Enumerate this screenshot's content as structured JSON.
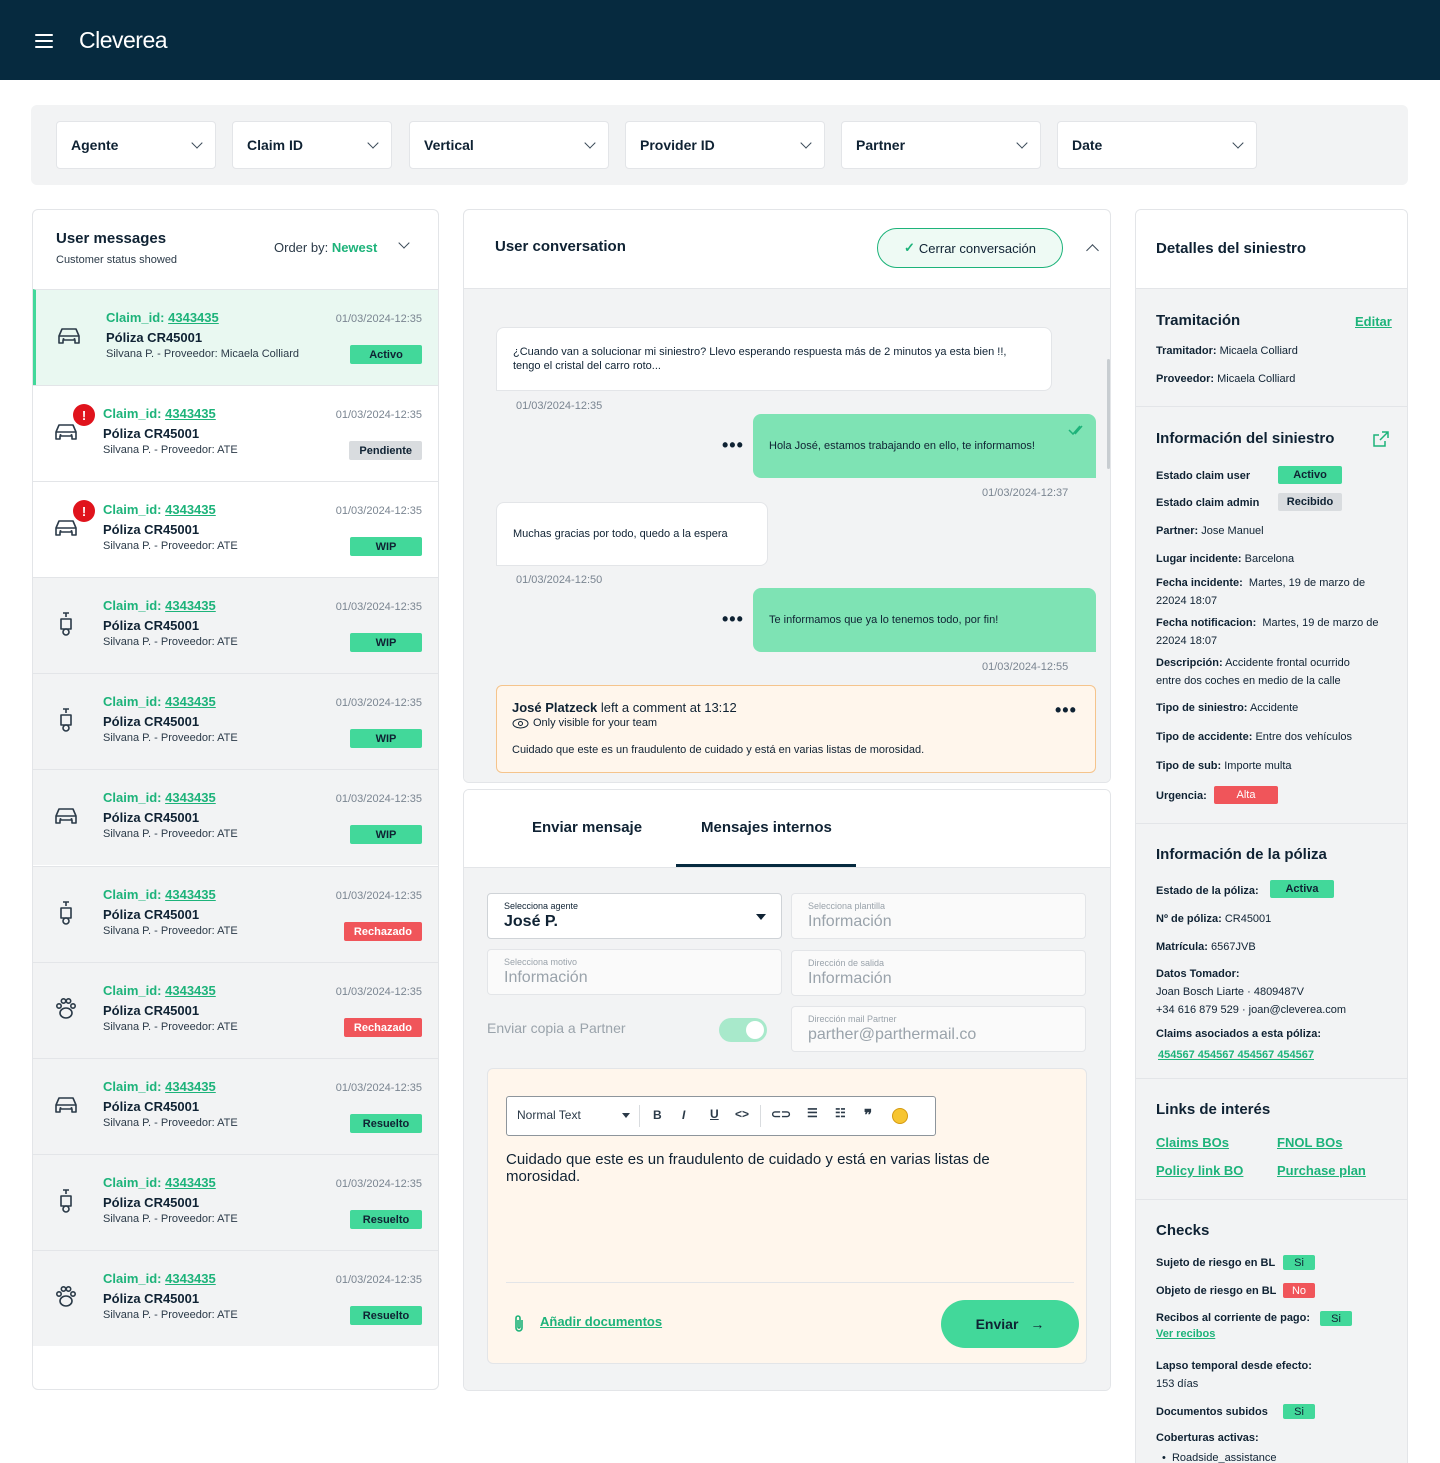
{
  "app": {
    "title": "Cleverea"
  },
  "filters": [
    "Agente",
    "Claim ID",
    "Vertical",
    "Provider ID",
    "Partner",
    "Date"
  ],
  "messages_panel": {
    "title": "User messages",
    "subtitle": "Customer status showed",
    "order_by_label": "Order by:",
    "order_by_value": "Newest",
    "items": [
      {
        "claim_label": "Claim_id:",
        "claim_id": "4343435",
        "policy": "Póliza CR45001",
        "provider": "Silvana P. - Proveedor: Micaela Colliard",
        "date": "01/03/2024-12:35",
        "status": "Activo",
        "status_color": "green",
        "icon": "car-icon",
        "alert": false,
        "active": true,
        "grey": false
      },
      {
        "claim_label": "Claim_id:",
        "claim_id": "4343435",
        "policy": "Póliza CR45001",
        "provider": "Silvana P. - Proveedor: ATE",
        "date": "01/03/2024-12:35",
        "status": "Pendiente",
        "status_color": "grey",
        "icon": "car-icon",
        "alert": true,
        "active": false,
        "grey": false
      },
      {
        "claim_label": "Claim_id:",
        "claim_id": "4343435",
        "policy": "Póliza CR45001",
        "provider": "Silvana P. - Proveedor: ATE",
        "date": "01/03/2024-12:35",
        "status": "WIP",
        "status_color": "green",
        "icon": "car-icon",
        "alert": true,
        "active": false,
        "grey": false
      },
      {
        "claim_label": "Claim_id:",
        "claim_id": "4343435",
        "policy": "Póliza CR45001",
        "provider": "Silvana P. - Proveedor: ATE",
        "date": "01/03/2024-12:35",
        "status": "WIP",
        "status_color": "green",
        "icon": "scooter-icon",
        "alert": false,
        "active": false,
        "grey": true
      },
      {
        "claim_label": "Claim_id:",
        "claim_id": "4343435",
        "policy": "Póliza CR45001",
        "provider": "Silvana P. - Proveedor: ATE",
        "date": "01/03/2024-12:35",
        "status": "WIP",
        "status_color": "green",
        "icon": "scooter-icon",
        "alert": false,
        "active": false,
        "grey": true
      },
      {
        "claim_label": "Claim_id:",
        "claim_id": "4343435",
        "policy": "Póliza CR45001",
        "provider": "Silvana P. - Proveedor: ATE",
        "date": "01/03/2024-12:35",
        "status": "WIP",
        "status_color": "green",
        "icon": "car-icon",
        "alert": false,
        "active": false,
        "grey": true
      },
      {
        "claim_label": "Claim_id:",
        "claim_id": "4343435",
        "policy": "Póliza CR45001",
        "provider": "Silvana P. - Proveedor: ATE",
        "date": "01/03/2024-12:35",
        "status": "Rechazado",
        "status_color": "red",
        "icon": "scooter-icon",
        "alert": false,
        "active": false,
        "grey": true
      },
      {
        "claim_label": "Claim_id:",
        "claim_id": "4343435",
        "policy": "Póliza CR45001",
        "provider": "Silvana P. - Proveedor: ATE",
        "date": "01/03/2024-12:35",
        "status": "Rechazado",
        "status_color": "red",
        "icon": "paw-icon",
        "alert": false,
        "active": false,
        "grey": true
      },
      {
        "claim_label": "Claim_id:",
        "claim_id": "4343435",
        "policy": "Póliza CR45001",
        "provider": "Silvana P. - Proveedor: ATE",
        "date": "01/03/2024-12:35",
        "status": "Resuelto",
        "status_color": "green",
        "icon": "car-icon",
        "alert": false,
        "active": false,
        "grey": true
      },
      {
        "claim_label": "Claim_id:",
        "claim_id": "4343435",
        "policy": "Póliza CR45001",
        "provider": "Silvana P. - Proveedor: ATE",
        "date": "01/03/2024-12:35",
        "status": "Resuelto",
        "status_color": "green",
        "icon": "scooter-icon",
        "alert": false,
        "active": false,
        "grey": true
      },
      {
        "claim_label": "Claim_id:",
        "claim_id": "4343435",
        "policy": "Póliza CR45001",
        "provider": "Silvana P. - Proveedor: ATE",
        "date": "01/03/2024-12:35",
        "status": "Resuelto",
        "status_color": "green",
        "icon": "paw-icon",
        "alert": false,
        "active": false,
        "grey": true
      }
    ]
  },
  "conversation": {
    "title": "User conversation",
    "close_button": "Cerrar conversación",
    "messages": [
      {
        "dir": "in",
        "text": "¿Cuando van a solucionar mi siniestro? Llevo esperando respuesta más de 2 minutos ya esta bien !!, tengo el cristal del carro roto...",
        "date": "01/03/2024-12:35"
      },
      {
        "dir": "out",
        "text": "Hola José, estamos trabajando en ello, te informamos!",
        "date": "01/03/2024-12:37"
      },
      {
        "dir": "in",
        "text": "Muchas gracias por todo, quedo a la espera",
        "date": "01/03/2024-12:50"
      },
      {
        "dir": "out",
        "text": "Te informamos que ya lo tenemos todo, por fin!",
        "date": "01/03/2024-12:55"
      }
    ],
    "comment": {
      "author": "José Platzeck",
      "action": "left a comment at 13:12",
      "visibility": "Only visible for your team",
      "text": "Cuidado que este es un fraudulento de cuidado y está en varias listas de morosidad."
    }
  },
  "composer": {
    "tabs": [
      "Enviar mensaje",
      "Mensajes internos"
    ],
    "agent": {
      "label": "Selecciona agente",
      "value": "José P."
    },
    "template": {
      "label": "Selecciona plantilla",
      "value": "Información"
    },
    "motive": {
      "label": "Selecciona motivo",
      "value": "Información"
    },
    "exit": {
      "label": "Dirección de salida",
      "value": "Información"
    },
    "copy_label": "Enviar copia a Partner",
    "partner_mail": {
      "label": "Dirección mail Partner",
      "value": "parther@parthermail.co"
    },
    "toolbar_style": "Normal Text",
    "body": "Cuidado que este es un fraudulento de cuidado y está en varias listas de morosidad.",
    "attach": "Añadir documentos",
    "send": "Enviar"
  },
  "details": {
    "title": "Detalles del siniestro",
    "tramitacion": {
      "title": "Tramitación",
      "edit": "Editar",
      "tramitador_k": "Tramitador:",
      "tramitador_v": "Micaela Colliard",
      "proveedor_k": "Proveedor:",
      "proveedor_v": "Micaela Colliard"
    },
    "info": {
      "title": "Información del siniestro",
      "estado_user_k": "Estado claim user",
      "estado_user_v": "Activo",
      "estado_admin_k": "Estado claim admin",
      "estado_admin_v": "Recibido",
      "partner_k": "Partner:",
      "partner_v": "Jose Manuel",
      "lugar_k": "Lugar incidente:",
      "lugar_v": "Barcelona",
      "fecha_inc_k": "Fecha incidente:",
      "fecha_inc_v1": "Martes, 19 de marzo de",
      "fecha_inc_v2": "22024 18:07",
      "fecha_not_k": "Fecha notificacion:",
      "fecha_not_v1": "Martes, 19 de marzo de",
      "fecha_not_v2": "22024 18:07",
      "desc_k": "Descripción:",
      "desc_v1": "Accidente frontal ocurrido",
      "desc_v2": "entre dos coches en medio de la calle",
      "tipo_sin_k": "Tipo de siniestro:",
      "tipo_sin_v": "Accidente",
      "tipo_acc_k": "Tipo de accidente:",
      "tipo_acc_v": "Entre dos vehículos",
      "tipo_sub_k": "Tipo de sub:",
      "tipo_sub_v": "Importe multa",
      "urgencia_k": "Urgencia:",
      "urgencia_v": "Alta"
    },
    "poliza": {
      "title": "Información de la póliza",
      "estado_k": "Estado de la póliza:",
      "estado_v": "Activa",
      "num_k": "Nº de póliza:",
      "num_v": "CR45001",
      "mat_k": "Matrícula:",
      "mat_v": "6567JVB",
      "tomador_k": "Datos Tomador:",
      "tomador_v1": "Joan Bosch Liarte · 4809487V",
      "tomador_v2": "+34 616 879 529 · joan@cleverea.com",
      "claims_k": "Claims asociados a esta póliza:",
      "claims_v": "454567 454567 454567 454567"
    },
    "links": {
      "title": "Links de interés",
      "l1": "Claims BOs",
      "l2": "FNOL BOs",
      "l3": "Policy link BO",
      "l4": "Purchase plan"
    },
    "checks": {
      "title": "Checks",
      "c1_k": "Sujeto de riesgo en BL",
      "c1_v": "Si",
      "c2_k": "Objeto de riesgo en BL",
      "c2_v": "No",
      "c3_k": "Recibos al corriente de pago:",
      "c3_v": "Si",
      "c3_link": "Ver recibos",
      "c4_k": "Lapso temporal desde efecto:",
      "c4_v": "153 días",
      "c5_k": "Documentos subidos",
      "c5_v": "Si",
      "c6_k": "Coberturas activas:",
      "c6_v": "Roadside_assistance"
    }
  },
  "colors": {
    "navy": "#062a3f",
    "green": "#42d89a",
    "link_green": "#1db37a",
    "red": "#f0555a",
    "alert_red": "#e0131c"
  }
}
